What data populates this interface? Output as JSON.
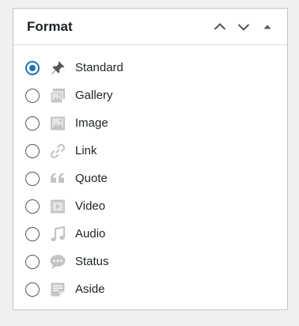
{
  "panel": {
    "title": "Format",
    "move_up_icon": "chevron-up-icon",
    "move_down_icon": "chevron-down-icon",
    "toggle_icon": "caret-up-icon"
  },
  "colors": {
    "accent": "#2271b1",
    "icon_grey": "#c3c4c7",
    "icon_dark": "#50575e"
  },
  "formats": {
    "selected": "Standard",
    "items": [
      {
        "label": "Standard",
        "icon": "pin-icon",
        "checked": true
      },
      {
        "label": "Gallery",
        "icon": "gallery-icon",
        "checked": false
      },
      {
        "label": "Image",
        "icon": "image-icon",
        "checked": false
      },
      {
        "label": "Link",
        "icon": "link-icon",
        "checked": false
      },
      {
        "label": "Quote",
        "icon": "quote-icon",
        "checked": false
      },
      {
        "label": "Video",
        "icon": "video-icon",
        "checked": false
      },
      {
        "label": "Audio",
        "icon": "audio-icon",
        "checked": false
      },
      {
        "label": "Status",
        "icon": "status-icon",
        "checked": false
      },
      {
        "label": "Aside",
        "icon": "aside-icon",
        "checked": false
      }
    ]
  }
}
